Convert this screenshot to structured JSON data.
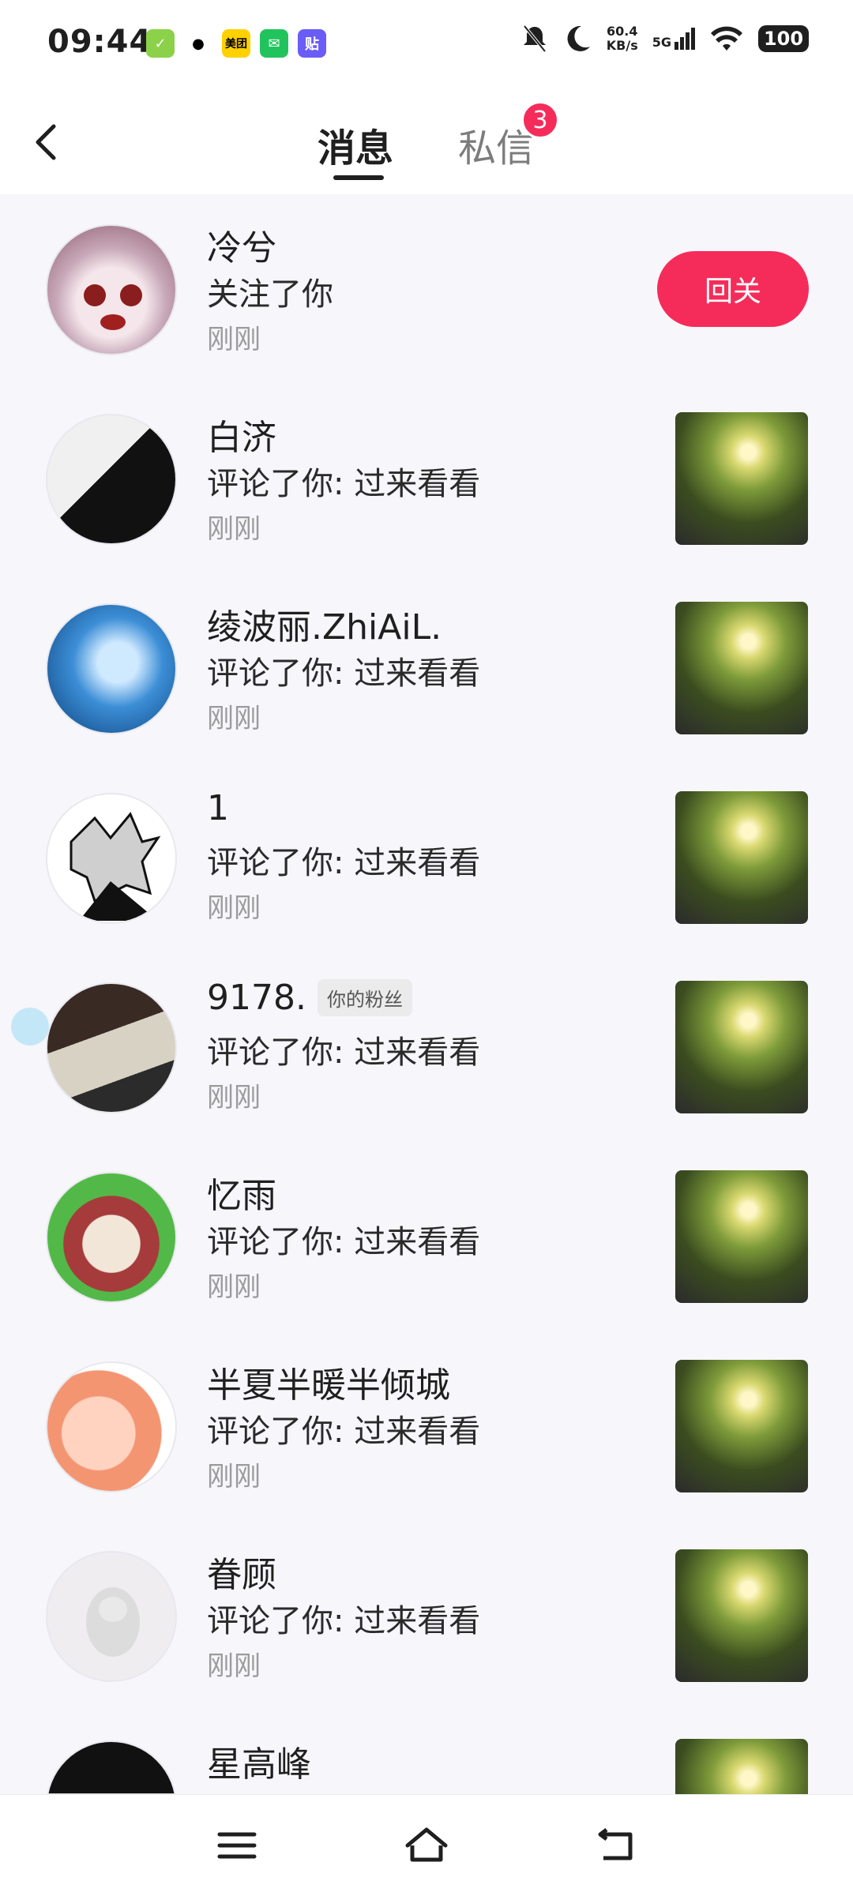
{
  "status_bar": {
    "time": "09:44",
    "net_speed_value": "60.4",
    "net_speed_unit": "KB/s",
    "network": "5G",
    "battery": "100",
    "apps": [
      {
        "name": "checkmark-app-icon",
        "color": "#8bd14a"
      },
      {
        "name": "qq-penguin-icon",
        "color": "#ffffff"
      },
      {
        "name": "meituan-icon",
        "color": "#ffd100",
        "text": "美团"
      },
      {
        "name": "wechat-icon",
        "color": "#21c45c"
      },
      {
        "name": "tieba-icon",
        "color": "#6a5cf6",
        "text": "贴"
      }
    ]
  },
  "header": {
    "tab_messages": "消息",
    "tab_dm": "私信",
    "dm_badge": "3"
  },
  "items": [
    {
      "name": "冷兮",
      "action": "关注了你",
      "time": "刚刚",
      "button": "回关"
    },
    {
      "name": "白济",
      "action": "评论了你: 过来看看",
      "time": "刚刚"
    },
    {
      "name": "绫波丽.ZhiAiL.",
      "action": "评论了你: 过来看看",
      "time": "刚刚"
    },
    {
      "name": "1",
      "action": "评论了你: 过来看看",
      "time": "刚刚"
    },
    {
      "name": "9178.",
      "tag": "你的粉丝",
      "action": "评论了你: 过来看看",
      "time": "刚刚"
    },
    {
      "name": "忆雨",
      "action": "评论了你: 过来看看",
      "time": "刚刚"
    },
    {
      "name": "半夏半暖半倾城",
      "action": "评论了你: 过来看看",
      "time": "刚刚"
    },
    {
      "name": "眷顾",
      "action": "评论了你: 过来看看",
      "time": "刚刚"
    },
    {
      "name": "星高峰",
      "action": "",
      "time": ""
    }
  ],
  "colors": {
    "accent": "#f52c5a",
    "background": "#f6f6fb"
  }
}
